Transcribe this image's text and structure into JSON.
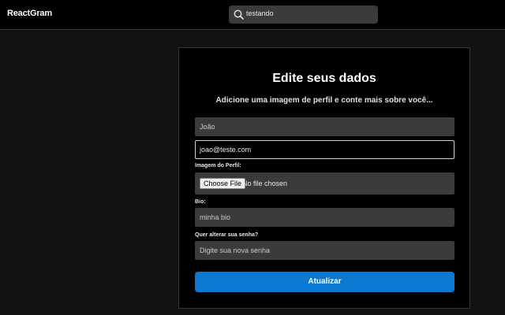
{
  "header": {
    "brand": "ReactGram",
    "search_value": "testando"
  },
  "form": {
    "title": "Edite seus dados",
    "subtitle": "Adicione uma imagem de perfil e conte mais sobre você...",
    "name_value": "João",
    "email_value": "joao@teste.com",
    "image_label": "Imagem do Perfil:",
    "file_button_label": "Choose File",
    "file_status": "No file chosen",
    "bio_label": "Bio:",
    "bio_placeholder": "minha bio",
    "password_label": "Quer alterar sua senha?",
    "password_placeholder": "Digite sua nova senha",
    "submit_label": "Atualizar"
  },
  "colors": {
    "accent": "#0b78d1",
    "background": "#121212",
    "input_bg": "#3b3b3b"
  },
  "icons": {
    "search": "search-icon"
  }
}
